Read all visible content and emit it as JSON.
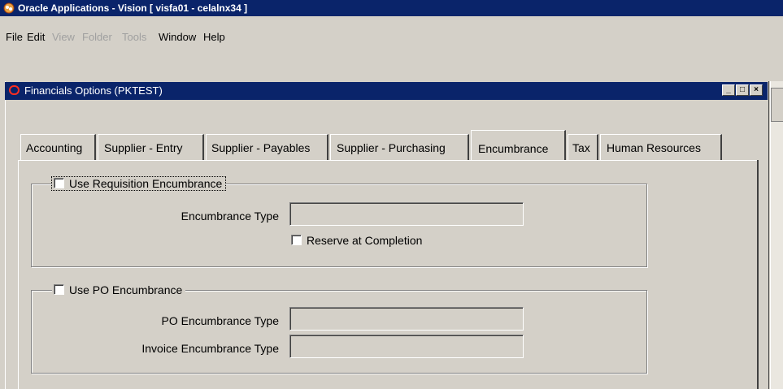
{
  "app_title": "Oracle Applications - Vision [ visfa01 - celalnx34 ]",
  "menu": [
    {
      "label": "File",
      "enabled": true
    },
    {
      "label": "Edit",
      "enabled": true
    },
    {
      "label": "View",
      "enabled": false
    },
    {
      "label": "Folder",
      "enabled": false
    },
    {
      "label": "Tools",
      "enabled": false
    },
    {
      "label": "Window",
      "enabled": true
    },
    {
      "label": "Help",
      "enabled": true
    }
  ],
  "toolbar": {
    "icons": [
      "new-icon",
      "find-icon",
      "navigator-icon",
      "save-icon",
      "next-step-icon",
      "switch-responsibility-icon",
      "print-icon",
      "close-form-icon",
      "cut-icon",
      "copy-icon",
      "paste-icon",
      "clear-record-icon",
      "delete-icon",
      "edit-field-icon",
      "zoom-icon",
      "translations-icon",
      "attachments-icon",
      "folder-tools-icon",
      "help-icon"
    ],
    "help_glyph": "?"
  },
  "window": {
    "title": "Financials Options (PKTEST)",
    "controls": [
      "_",
      "□",
      "×"
    ]
  },
  "tabs": [
    {
      "label": "Accounting",
      "active": false
    },
    {
      "label": "Supplier - Entry",
      "active": false
    },
    {
      "label": "Supplier - Payables",
      "active": false
    },
    {
      "label": "Supplier - Purchasing",
      "active": false
    },
    {
      "label": "Encumbrance",
      "active": true
    },
    {
      "label": "Tax",
      "active": false
    },
    {
      "label": "Human Resources",
      "active": false
    }
  ],
  "requisition_group": {
    "checkbox_label": "Use Requisition Encumbrance",
    "checked": false,
    "encumbrance_type_label": "Encumbrance Type",
    "encumbrance_type_value": "",
    "reserve_label": "Reserve at Completion",
    "reserve_checked": false
  },
  "po_group": {
    "checkbox_label": "Use PO Encumbrance",
    "checked": false,
    "po_type_label": "PO Encumbrance Type",
    "po_type_value": "",
    "invoice_type_label": "Invoice Encumbrance Type",
    "invoice_type_value": ""
  },
  "colors": {
    "titlebar": "#0a246a",
    "face": "#d4d0c8",
    "oracle_red": "#ff2e1f"
  }
}
